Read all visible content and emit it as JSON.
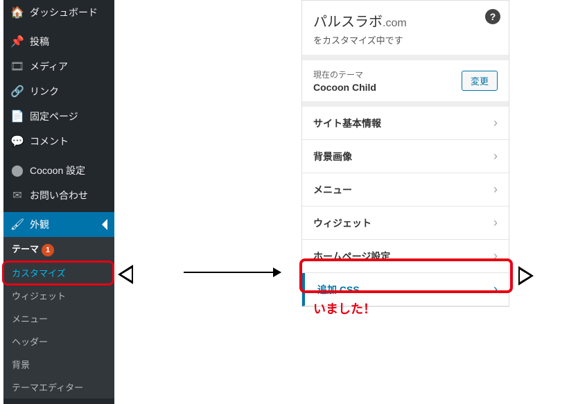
{
  "wp_sidebar": {
    "items": [
      {
        "icon": "🏠",
        "label": "ダッシュボード",
        "name": "dashboard"
      },
      {
        "sep": true
      },
      {
        "icon": "📌",
        "label": "投稿",
        "name": "posts"
      },
      {
        "icon": "🎞",
        "label": "メディア",
        "name": "media"
      },
      {
        "icon": "🔗",
        "label": "リンク",
        "name": "links"
      },
      {
        "icon": "📄",
        "label": "固定ページ",
        "name": "pages"
      },
      {
        "icon": "💬",
        "label": "コメント",
        "name": "comments"
      },
      {
        "sep": true
      },
      {
        "icon": "⬤",
        "label": "Cocoon 設定",
        "name": "cocoon-settings"
      },
      {
        "icon": "✉",
        "label": "お問い合わせ",
        "name": "contact"
      },
      {
        "sep": true
      },
      {
        "icon": "🖌",
        "label": "外観",
        "name": "appearance",
        "active": true
      }
    ],
    "submenu": [
      {
        "label": "テーマ",
        "name": "themes",
        "current": true,
        "badge": "1"
      },
      {
        "label": "カスタマイズ",
        "name": "customize",
        "highlighted": true
      },
      {
        "label": "ウィジェット",
        "name": "widgets"
      },
      {
        "label": "メニュー",
        "name": "menus"
      },
      {
        "label": "ヘッダー",
        "name": "header"
      },
      {
        "label": "背景",
        "name": "background"
      },
      {
        "label": "テーマエディター",
        "name": "theme-editor"
      }
    ]
  },
  "customizer": {
    "site_title": "パルスラボ",
    "domain_suffix": ".com",
    "subtitle": "をカスタマイズ中です",
    "help_glyph": "?",
    "theme_label": "現在のテーマ",
    "theme_name": "Cocoon Child",
    "change_label": "変更",
    "rows": [
      {
        "label": "サイト基本情報",
        "name": "site-identity"
      },
      {
        "label": "背景画像",
        "name": "background-image"
      },
      {
        "label": "メニュー",
        "name": "menus"
      },
      {
        "label": "ウィジェット",
        "name": "widgets"
      },
      {
        "label": "ホームページ設定",
        "name": "homepage-settings"
      },
      {
        "label": "追加 CSS",
        "name": "additional-css",
        "accent": true
      }
    ],
    "chevron": "›"
  },
  "caption": "いました！"
}
